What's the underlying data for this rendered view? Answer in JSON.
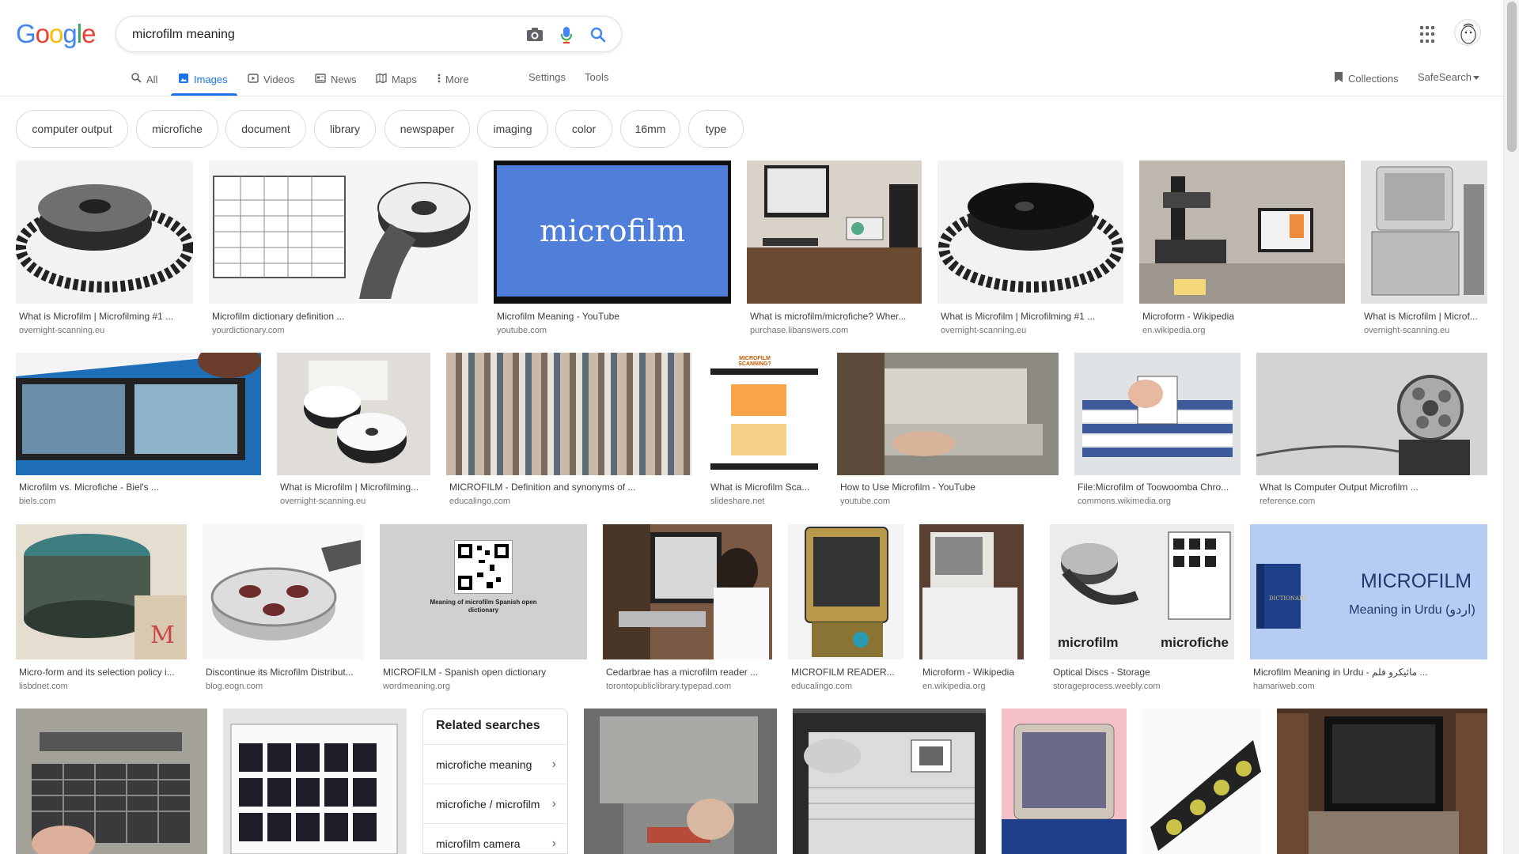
{
  "search": {
    "query": "microfilm meaning"
  },
  "tabs": [
    {
      "label": "All",
      "icon": "search-icon"
    },
    {
      "label": "Images",
      "icon": "image-icon"
    },
    {
      "label": "Videos",
      "icon": "video-icon"
    },
    {
      "label": "News",
      "icon": "news-icon"
    },
    {
      "label": "Maps",
      "icon": "map-icon"
    },
    {
      "label": "More",
      "icon": "more-vert-icon"
    }
  ],
  "settings_label": "Settings",
  "tools_label": "Tools",
  "collections_label": "Collections",
  "safesearch_label": "SafeSearch",
  "chips": [
    "computer output",
    "microfiche",
    "document",
    "library",
    "newspaper",
    "imaging",
    "color",
    "16mm",
    "type"
  ],
  "results": [
    {
      "caption": "What is Microfilm | Microfilming #1 ...",
      "source": "overnight-scanning.eu"
    },
    {
      "caption": "Microfilm dictionary definition ...",
      "source": "yourdictionary.com"
    },
    {
      "caption": "Microfilm Meaning - YouTube",
      "source": "youtube.com",
      "thumb_text": "microfilm"
    },
    {
      "caption": "What is microfilm/microfiche? Wher...",
      "source": "purchase.libanswers.com"
    },
    {
      "caption": "What is Microfilm | Microfilming #1 ...",
      "source": "overnight-scanning.eu"
    },
    {
      "caption": "Microform - Wikipedia",
      "source": "en.wikipedia.org"
    },
    {
      "caption": "What is Microfilm | Microf...",
      "source": "overnight-scanning.eu"
    },
    {
      "caption": "Microfilm vs. Microfiche - Biel's ...",
      "source": "biels.com"
    },
    {
      "caption": "What is Microfilm | Microfilming...",
      "source": "overnight-scanning.eu"
    },
    {
      "caption": "MICROFILM - Definition and synonyms of ...",
      "source": "educalingo.com"
    },
    {
      "caption": "What is Microfilm Sca...",
      "source": "slideshare.net",
      "thumb_text": "MICROFILM SCANNING?"
    },
    {
      "caption": "How to Use Microfilm - YouTube",
      "source": "youtube.com"
    },
    {
      "caption": "File:Microfilm of Toowoomba Chro...",
      "source": "commons.wikimedia.org"
    },
    {
      "caption": "What Is Computer Output Microfilm ...",
      "source": "reference.com"
    },
    {
      "caption": "Micro-form and its selection policy i...",
      "source": "lisbdnet.com"
    },
    {
      "caption": "Discontinue its Microfilm Distribut...",
      "source": "blog.eogn.com"
    },
    {
      "caption": "MICROFILM - Spanish open dictionary",
      "source": "wordmeaning.org",
      "thumb_text": "Meaning of microfilm Spanish open dictionary"
    },
    {
      "caption": "Cedarbrae has a microfilm reader ...",
      "source": "torontopubliclibrary.typepad.com"
    },
    {
      "caption": "MICROFILM READER...",
      "source": "educalingo.com"
    },
    {
      "caption": "Microform - Wikipedia",
      "source": "en.wikipedia.org"
    },
    {
      "caption": "Optical Discs - Storage",
      "source": "storageprocess.weebly.com",
      "thumb_text_a": "microfilm",
      "thumb_text_b": "microfiche"
    },
    {
      "caption": "Microfilm Meaning in Urdu - مائیکرو فلم ...",
      "source": "hamariweb.com",
      "thumb_text_a": "MICROFILM",
      "thumb_text_b": "Meaning in Urdu (اردو)"
    }
  ],
  "related": {
    "title": "Related searches",
    "items": [
      "microfiche meaning",
      "microfiche / microfilm",
      "microfilm camera"
    ]
  },
  "colors": {
    "blue": "#1a73e8",
    "logo_blue": "#4285f4",
    "logo_red": "#ea4335",
    "logo_yellow": "#fbbc05",
    "logo_green": "#34a853"
  }
}
